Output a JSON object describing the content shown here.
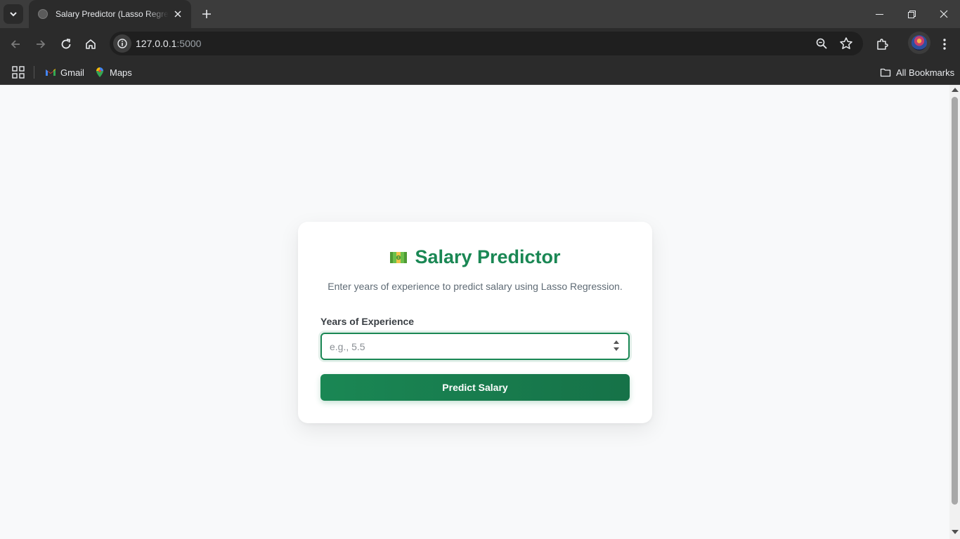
{
  "browser": {
    "tab_title": "Salary Predictor (Lasso Regression)",
    "url_host": "127.0.0.1",
    "url_port": ":5000",
    "bookmarks": [
      {
        "label": "Gmail",
        "icon": "gmail-icon"
      },
      {
        "label": "Maps",
        "icon": "maps-icon"
      }
    ],
    "all_bookmarks_label": "All Bookmarks"
  },
  "page": {
    "title": "Salary Predictor",
    "title_icon": "money-icon",
    "subtitle": "Enter years of experience to predict salary using Lasso Regression.",
    "field_label": "Years of Experience",
    "input_placeholder": "e.g., 5.5",
    "input_value": "",
    "button_label": "Predict Salary"
  },
  "colors": {
    "accent": "#1a8754",
    "page_bg": "#f8f9fa",
    "chrome_dark": "#2b2b2b"
  }
}
